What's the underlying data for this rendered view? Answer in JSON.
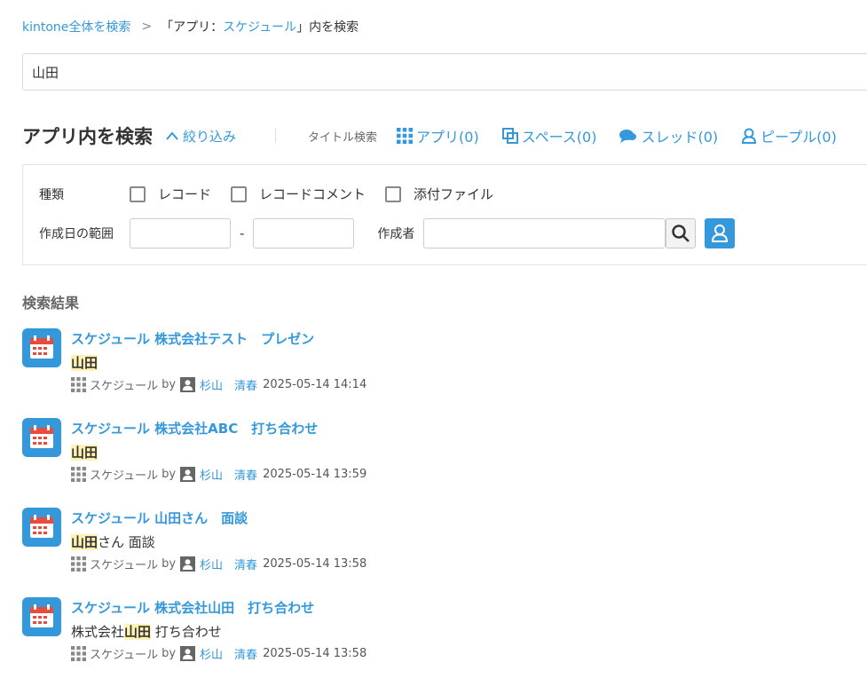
{
  "breadcrumb": {
    "root": "kintone全体を検索",
    "separator": ">",
    "current_prefix": "「アプリ：",
    "current_app": "スケジュール",
    "current_suffix": "」内を検索"
  },
  "search": {
    "value": "山田"
  },
  "header": {
    "title": "アプリ内を検索",
    "narrow_label": "絞り込み",
    "title_search_label": "タイトル検索",
    "filters": [
      {
        "label": "アプリ(0)",
        "icon": "grid-icon"
      },
      {
        "label": "スペース(0)",
        "icon": "space-icon"
      },
      {
        "label": "スレッド(0)",
        "icon": "thread-icon"
      },
      {
        "label": "ピープル(0)",
        "icon": "people-icon"
      }
    ]
  },
  "panel": {
    "type_label": "種類",
    "checkboxes": [
      "レコード",
      "レコードコメント",
      "添付ファイル"
    ],
    "date_range_label": "作成日の範囲",
    "date_separator": "-",
    "creator_label": "作成者"
  },
  "results": {
    "title": "検索結果",
    "items": [
      {
        "title": "スケジュール 株式会社テスト　プレゼン",
        "snippet_before": "",
        "snippet_highlight": "山田",
        "snippet_after": "",
        "app": "スケジュール",
        "by": "by",
        "user": "杉山　清春",
        "date": "2025-05-14 14:14"
      },
      {
        "title": "スケジュール 株式会社ABC　打ち合わせ",
        "snippet_before": "",
        "snippet_highlight": "山田",
        "snippet_after": "",
        "app": "スケジュール",
        "by": "by",
        "user": "杉山　清春",
        "date": "2025-05-14 13:59"
      },
      {
        "title": "スケジュール 山田さん　面談",
        "snippet_before": "",
        "snippet_highlight": "山田",
        "snippet_after": "さん 面談",
        "app": "スケジュール",
        "by": "by",
        "user": "杉山　清春",
        "date": "2025-05-14 13:58"
      },
      {
        "title": "スケジュール 株式会社山田　打ち合わせ",
        "snippet_before": "株式会社",
        "snippet_highlight": "山田",
        "snippet_after": " 打ち合わせ",
        "app": "スケジュール",
        "by": "by",
        "user": "杉山　清春",
        "date": "2025-05-14 13:58"
      }
    ]
  },
  "colors": {
    "link": "#3498db",
    "highlight": "#fff2b3",
    "icon_blue": "#3498db"
  }
}
